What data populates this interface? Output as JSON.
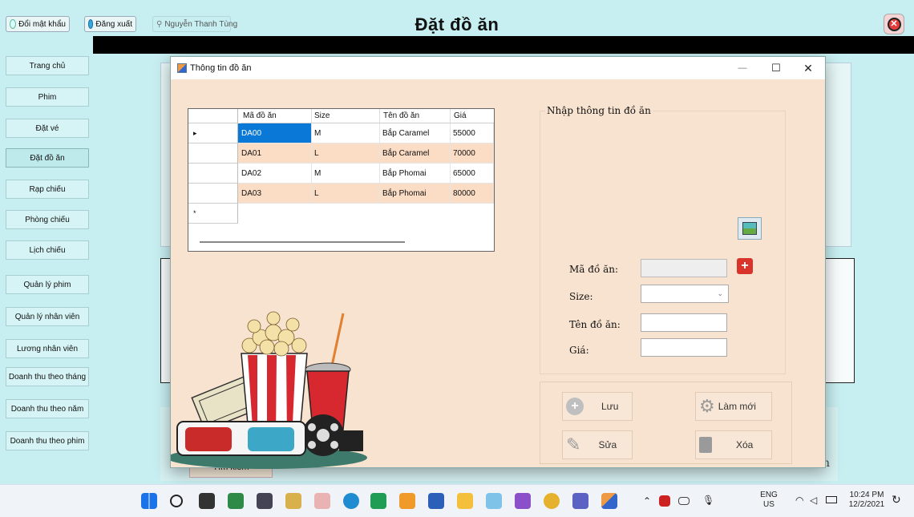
{
  "app": {
    "title": "Đặt đồ ăn",
    "change_password": "Đổi mật khẩu",
    "logout": "Đăng xuất",
    "user": "Nguyễn Thanh Tùng"
  },
  "sidebar": {
    "items": [
      {
        "label": "Trang chủ"
      },
      {
        "label": "Phim"
      },
      {
        "label": "Đặt vé"
      },
      {
        "label": "Đặt đồ ăn",
        "active": true
      },
      {
        "label": "Rạp chiếu"
      },
      {
        "label": "Phòng chiếu"
      },
      {
        "label": "Lịch chiếu"
      },
      {
        "label": "Quản lý phim"
      },
      {
        "label": "Quản lý nhân viên"
      },
      {
        "label": "Lương nhân viên"
      },
      {
        "label": "Doanh thu theo tháng"
      },
      {
        "label": "Doanh thu theo năm"
      },
      {
        "label": "Doanh thu theo phim"
      }
    ]
  },
  "background": {
    "search_button": "Tìm kiếm",
    "partial_label": "n"
  },
  "dialog": {
    "title": "Thông tin đồ ăn",
    "minimize": "—",
    "maximize": "☐",
    "close": "✕",
    "grid": {
      "columns": [
        "Mã đồ ăn",
        "Size",
        "Tên đồ ăn",
        "Giá"
      ],
      "rows": [
        [
          "DA00",
          "M",
          "Bắp Caramel",
          "55000"
        ],
        [
          "DA01",
          "L",
          "Bắp Caramel",
          "70000"
        ],
        [
          "DA02",
          "M",
          "Bắp Phomai",
          "65000"
        ],
        [
          "DA03",
          "L",
          "Bắp Phomai",
          "80000"
        ]
      ],
      "current_row_marker": "▸",
      "new_row_marker": "*"
    },
    "form": {
      "group_title": "Nhập thông tin đồ ăn",
      "id_label": "Mã đồ ăn:",
      "size_label": "Size:",
      "name_label": "Tên đồ ăn:",
      "price_label": "Giá:",
      "id_value": "",
      "size_value": "",
      "name_value": "",
      "price_value": "",
      "add_id_symbol": "+"
    },
    "buttons": {
      "save": "Lưu",
      "refresh": "Làm mới",
      "edit": "Sửa",
      "delete": "Xóa"
    }
  },
  "taskbar": {
    "lang_line1": "ENG",
    "lang_line2": "US",
    "time": "10:24 PM",
    "date": "12/2/2021"
  }
}
